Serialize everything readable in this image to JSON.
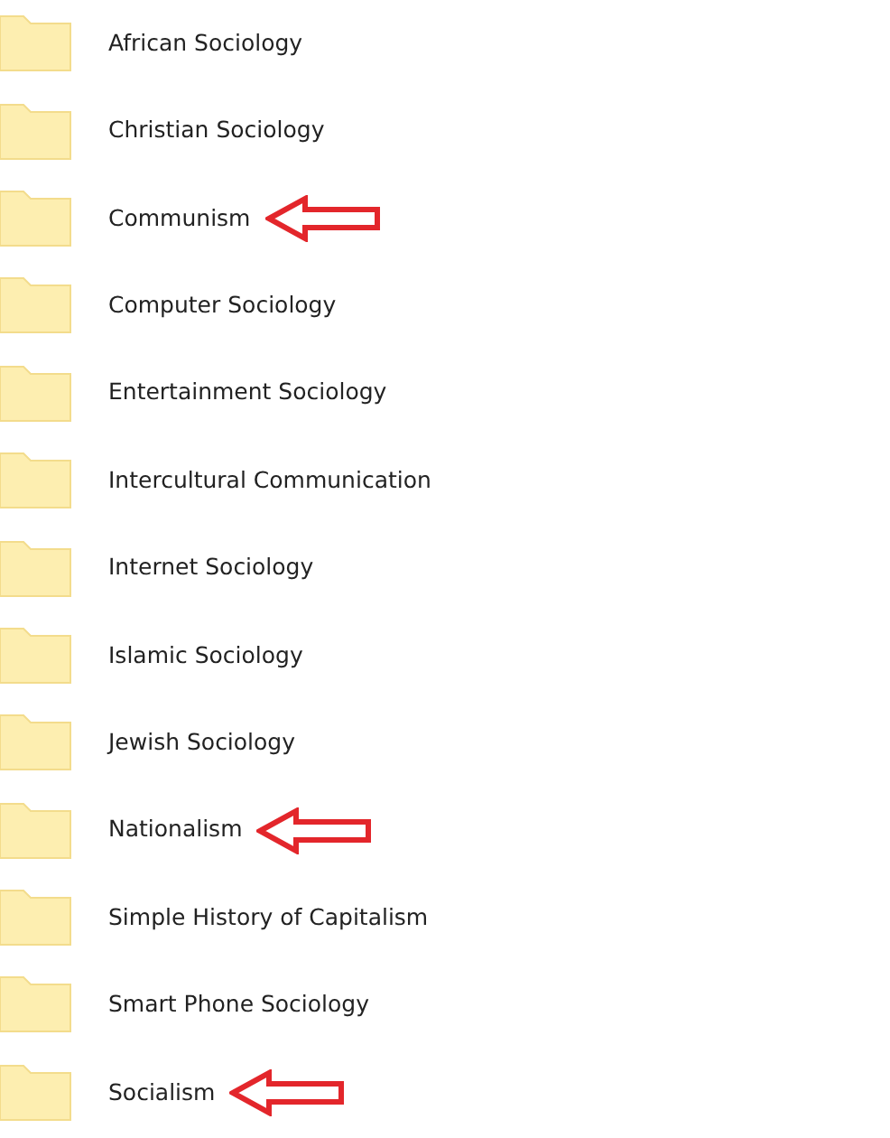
{
  "folders": [
    {
      "name": "African Sociology",
      "marked": false
    },
    {
      "name": "Christian Sociology",
      "marked": false
    },
    {
      "name": "Communism",
      "marked": true
    },
    {
      "name": "Computer Sociology",
      "marked": false
    },
    {
      "name": "Entertainment Sociology",
      "marked": false
    },
    {
      "name": "Intercultural Communication",
      "marked": false
    },
    {
      "name": "Internet Sociology",
      "marked": false
    },
    {
      "name": "Islamic Sociology",
      "marked": false
    },
    {
      "name": "Jewish Sociology",
      "marked": false
    },
    {
      "name": "Nationalism",
      "marked": true
    },
    {
      "name": "Simple History of Capitalism",
      "marked": false
    },
    {
      "name": "Smart Phone Sociology",
      "marked": false
    },
    {
      "name": "Socialism",
      "marked": true
    }
  ]
}
